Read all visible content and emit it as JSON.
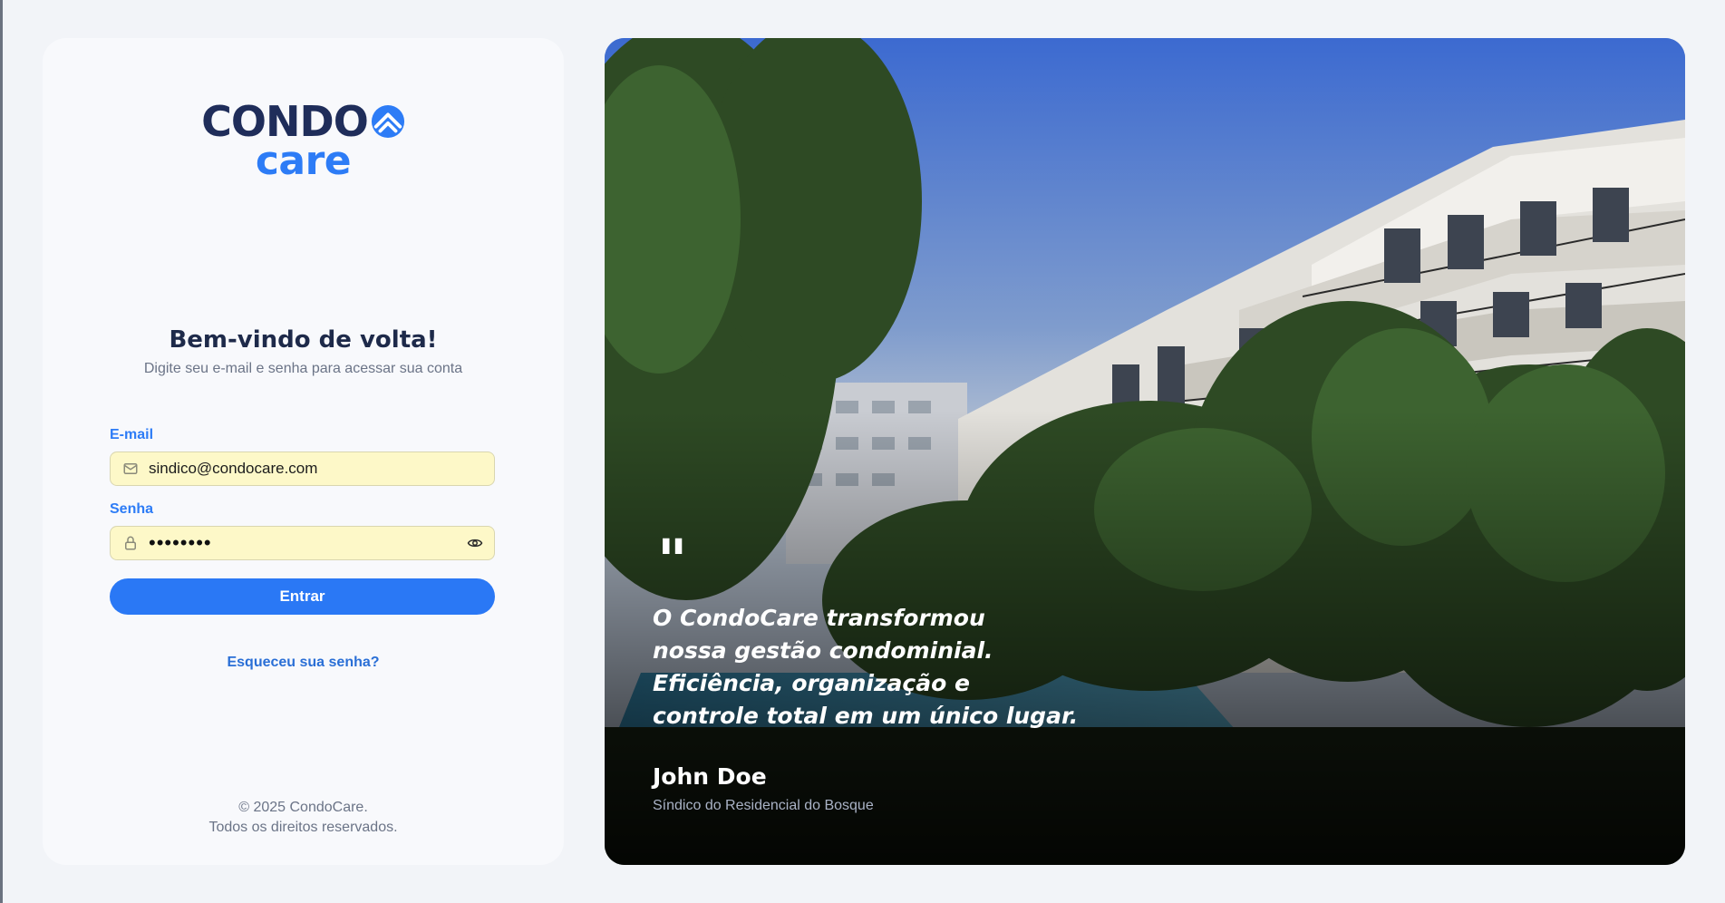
{
  "logo": {
    "line1": "CONDO",
    "line2": "care",
    "brand_dark": "#1f2d5a",
    "brand_blue": "#2d7cf6"
  },
  "login": {
    "title": "Bem-vindo de volta!",
    "subtitle": "Digite seu e-mail e senha para acessar sua conta",
    "email_label": "E-mail",
    "email_value": "sindico@condocare.com",
    "password_label": "Senha",
    "password_value": "••••••••",
    "submit_label": "Entrar",
    "forgot_label": "Esqueceu sua senha?",
    "email_icon": "mail-icon",
    "password_icon": "lock-icon",
    "toggle_icon": "eye-icon"
  },
  "footer": {
    "copyright": "© 2025 CondoCare.",
    "rights": "Todos os direitos reservados."
  },
  "testimonial": {
    "quote_mark": "\"",
    "lines": [
      "O CondoCare transformou",
      "nossa gestão condominial.",
      "Eficiência, organização e",
      "controle total em um único lugar."
    ],
    "author": "John Doe",
    "role": "Síndico do Residencial do Bosque"
  },
  "colors": {
    "accent": "#2a78f5",
    "input_autofill": "#fdf8c8",
    "page_bg": "#f2f4f8"
  }
}
